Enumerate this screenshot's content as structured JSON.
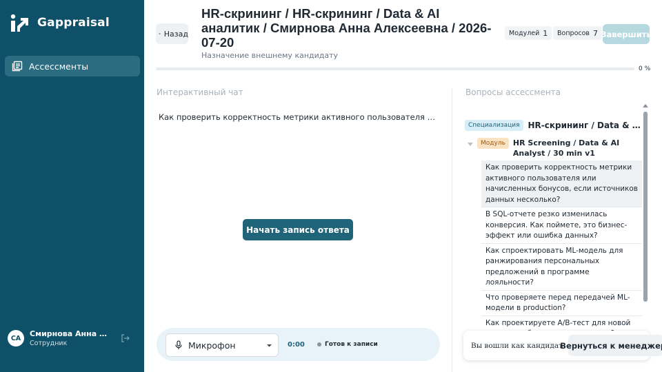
{
  "app": {
    "name": "Gappraisal"
  },
  "sidebar": {
    "items": [
      {
        "label": "Ассессменты",
        "icon": "list-icon",
        "active": true
      }
    ],
    "user": {
      "initials": "CA",
      "name": "Смирнова Анна Алексеевна",
      "role": "Сотрудник"
    }
  },
  "header": {
    "back_label": "Назад",
    "title": "HR-скрининг / HR-скрининг / Data & AI аналитик / Смирнова Анна Алексеевна / 2026-07-20",
    "subtitle": "Назначение внешнему кандидату",
    "stats": [
      {
        "label": "Модулей",
        "value": "1"
      },
      {
        "label": "Вопросов",
        "value": "7"
      }
    ],
    "finish_label": "Завершить",
    "progress": {
      "percent": 0,
      "label": "0 %"
    }
  },
  "chat": {
    "title": "Интерактивный чат",
    "question": "Как проверить корректность метрики активного пользователя или начисленных бонусов, если источников данных несколько?",
    "record_label": "Начать запись ответа",
    "mic_label": "Микрофон",
    "timer": "0:00",
    "status": "Готов к записи"
  },
  "questions": {
    "title": "Вопросы ассессмента",
    "spec_tag": "Специализация",
    "spec_name": "HR-скрининг / Data & AI аналитик",
    "module_tag": "Модуль",
    "module_name": "HR Screening / Data & AI Analyst / 30 min v1",
    "items": [
      "Как проверить корректность метрики активного пользователя или начисленных бонусов, если источников данных несколько?",
      "В SQL-отчете резко изменилась конверсия. Как поймете, это бизнес-эффект или ошибка данных?",
      "Как спроектировать ML-модель для ранжирования персональных предложений в программе лояльности?",
      "Что проверяете перед передачей ML-модели в production?",
      "Как проектируете A/B-тест для новой акции или бонусного механизма?"
    ]
  },
  "toast": {
    "text": "Вы вошли как кандидат",
    "button_label": "Вернуться к менеджеру"
  },
  "colors": {
    "sidebar": "#0e5068",
    "accent": "#1f6478",
    "finish_disabled": "#b6d9e0"
  }
}
